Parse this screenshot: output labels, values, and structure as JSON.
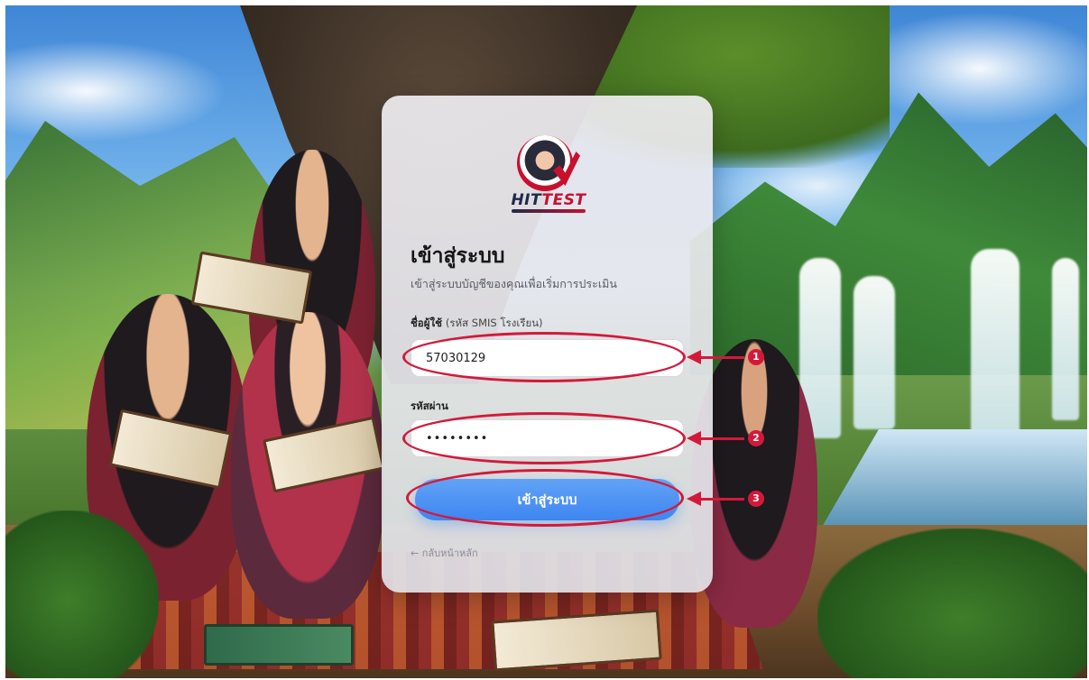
{
  "brand": {
    "logo_main": "HIT",
    "logo_accent": "TEST"
  },
  "login": {
    "title": "เข้าสู่ระบบ",
    "subtitle": "เข้าสู่ระบบบัญชีของคุณเพื่อเริ่มการประเมิน",
    "username_label": "ชื่อผู้ใช้",
    "username_hint": "(รหัส SMIS โรงเรียน)",
    "username_value": "57030129",
    "password_label": "รหัสผ่าน",
    "password_value": "••••••••",
    "submit_label": "เข้าสู่ระบบ",
    "back_link": "← กลับหน้าหลัก"
  },
  "annotations": {
    "badges": [
      "1",
      "2",
      "3"
    ],
    "color": "#d3193b"
  },
  "colors": {
    "button": "#4a90f2",
    "card": "#ebebef"
  }
}
